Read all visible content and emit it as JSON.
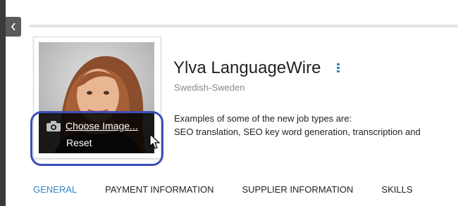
{
  "profile": {
    "name": "Ylva LanguageWire",
    "locale": "Swedish-Sweden",
    "description_line1": "Examples of some of the new job types are:",
    "description_line2": "SEO translation, SEO key word generation, transcription and"
  },
  "photo_menu": {
    "choose_image_label": "Choose Image...",
    "reset_label": "Reset"
  },
  "tabs": [
    {
      "label": "GENERAL",
      "active": true
    },
    {
      "label": "PAYMENT INFORMATION",
      "active": false
    },
    {
      "label": "SUPPLIER INFORMATION",
      "active": false
    },
    {
      "label": "SKILLS",
      "active": false
    }
  ],
  "colors": {
    "accent": "#2f86c4",
    "highlight_ring": "#3a4fb8",
    "sidebar": "#3a3a3a"
  },
  "icons": {
    "collapse": "chevron-left-icon",
    "camera": "camera-icon",
    "menu": "kebab-icon",
    "cursor": "mouse-cursor-icon"
  }
}
